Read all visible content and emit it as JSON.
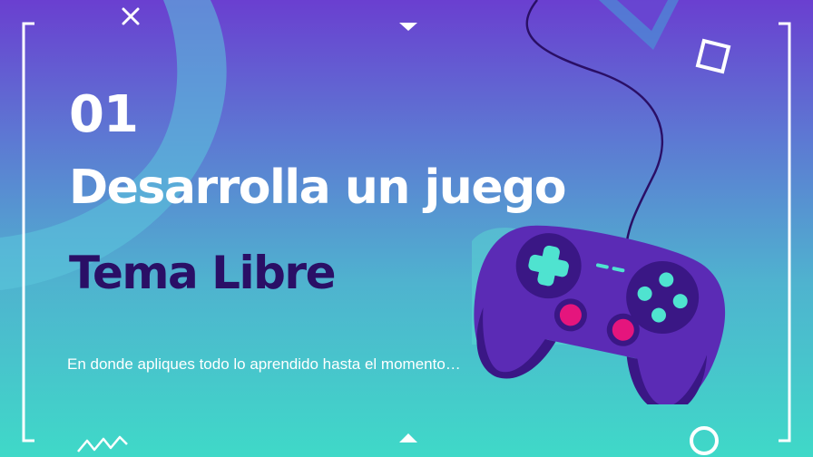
{
  "slide": {
    "number": "01",
    "title": "Desarrolla un juego",
    "subtitle": "Tema Libre",
    "description": "En donde apliques todo lo aprendido hasta el momento…"
  },
  "colors": {
    "background_top": "#6a3fd0",
    "background_bottom": "#3fd9c8",
    "title_text": "#ffffff",
    "subtitle_text": "#2a0f66",
    "controller_body": "#5b2bb5",
    "controller_buttons": "#4fe3d0",
    "controller_triggers": "#e5157d"
  },
  "icons": [
    "bracket-left-icon",
    "bracket-right-icon",
    "x-mark-icon",
    "square-outline-icon",
    "triangle-down-icon",
    "triangle-up-icon",
    "circle-outline-icon",
    "zigzag-icon",
    "game-controller-icon"
  ]
}
